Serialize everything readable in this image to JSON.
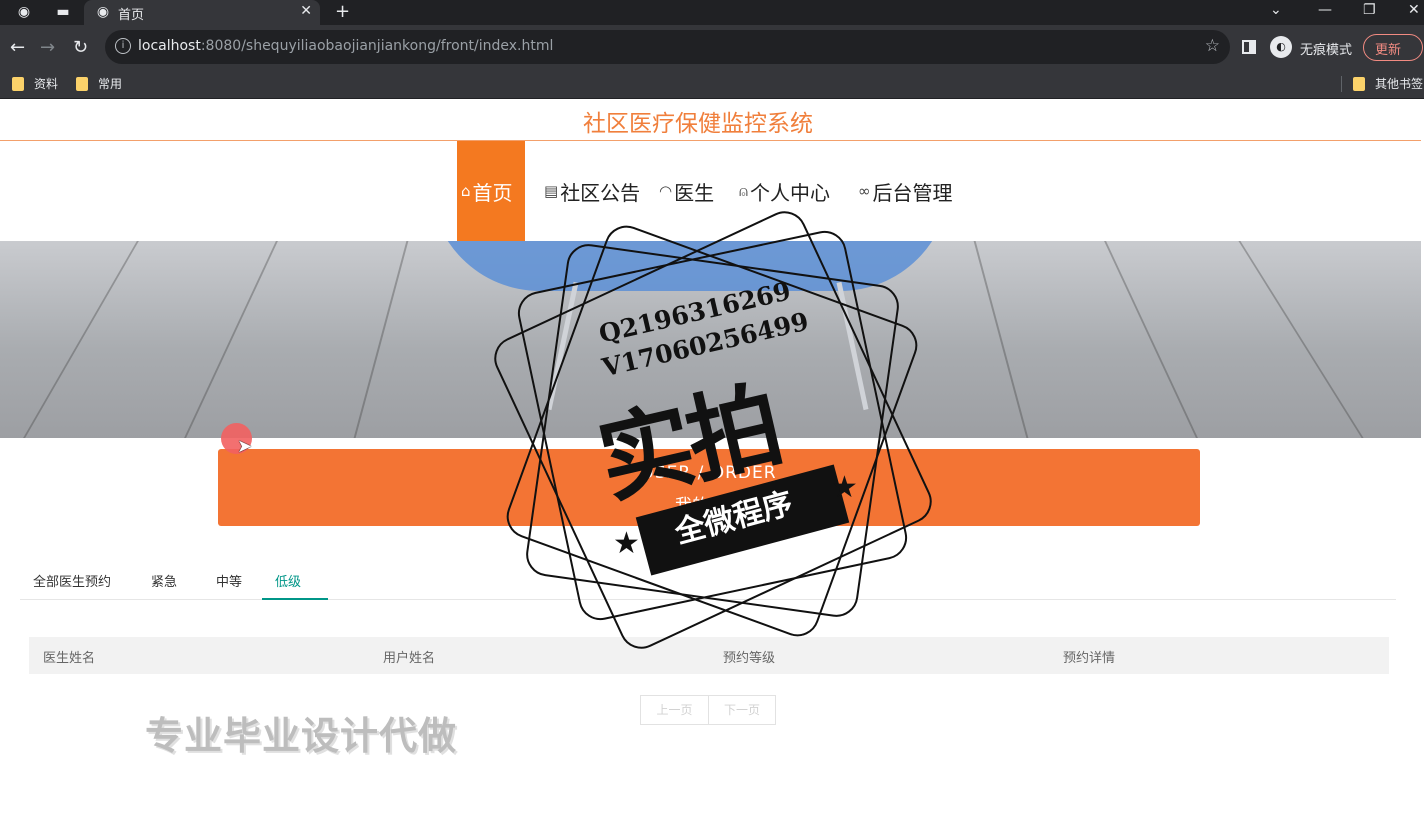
{
  "browser": {
    "tab_title": "首页",
    "url_host": "localhost",
    "url_rest": ":8080/shequyiliaobaojianjiankong/front/index.html",
    "incognito_label": "无痕模式",
    "update_label": "更新",
    "bookmarks": [
      "资料",
      "常用"
    ],
    "other_bookmarks": "其他书签"
  },
  "site": {
    "title": "社区医疗保健监控系统",
    "accent": "#f47920"
  },
  "nav": [
    {
      "icon": "home-icon",
      "glyph": "⌂",
      "label": "首页"
    },
    {
      "icon": "notice-icon",
      "glyph": "▤",
      "label": "社区公告"
    },
    {
      "icon": "dashboard-icon",
      "glyph": "◠",
      "label": "医生"
    },
    {
      "icon": "user-icon",
      "glyph": "⍝",
      "label": "个人中心"
    },
    {
      "icon": "link-icon",
      "glyph": "∞",
      "label": "后台管理"
    }
  ],
  "order_section": {
    "title_en": "USER / ORDER",
    "title_cn": "我的医生"
  },
  "filter_tabs": [
    "全部医生预约",
    "紧急",
    "中等",
    "低级"
  ],
  "table": {
    "headers": [
      "医生姓名",
      "用户姓名",
      "预约等级",
      "预约详情"
    ]
  },
  "pager": {
    "prev": "上一页",
    "next": "下一页"
  },
  "watermark": {
    "qq": "Q2196316269",
    "vx": "V17060256499",
    "big": "实拍",
    "ribbon": "全微程序",
    "bottom": "专业毕业设计代做"
  }
}
